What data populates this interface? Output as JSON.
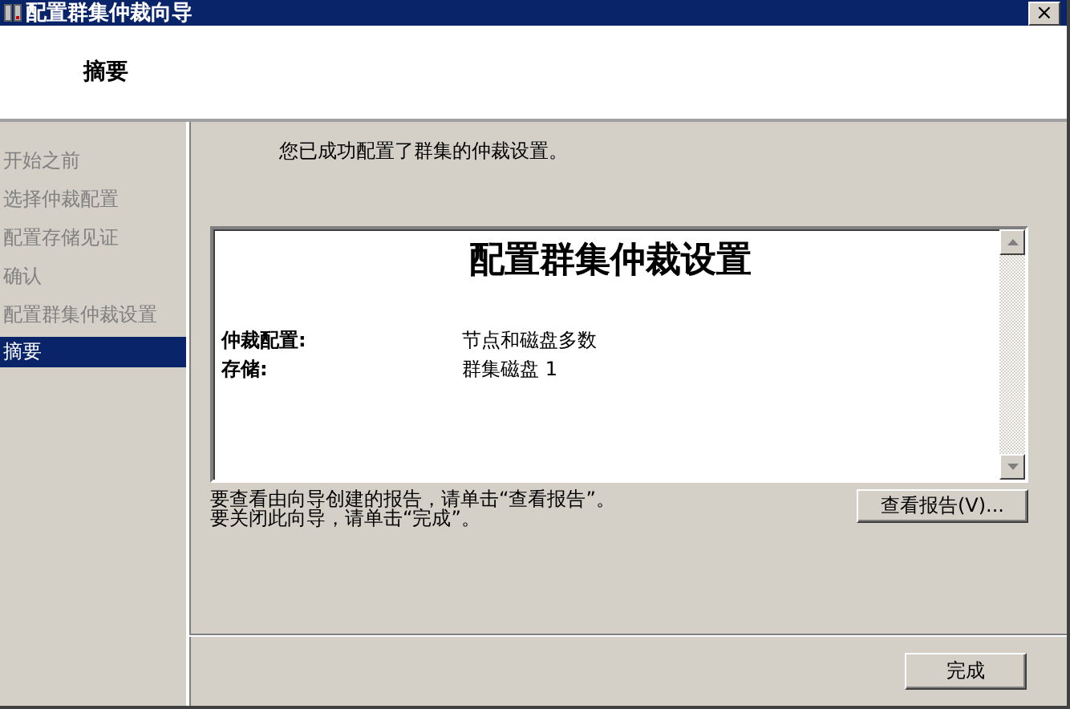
{
  "window": {
    "title": "配置群集仲裁向导",
    "close": "×"
  },
  "header": {
    "title": "摘要"
  },
  "sidebar": {
    "items": [
      {
        "label": "开始之前",
        "selected": false
      },
      {
        "label": "选择仲裁配置",
        "selected": false
      },
      {
        "label": "配置存储见证",
        "selected": false
      },
      {
        "label": "确认",
        "selected": false
      },
      {
        "label": "配置群集仲裁设置",
        "selected": false
      },
      {
        "label": "摘要",
        "selected": true
      }
    ]
  },
  "main": {
    "message": "您已成功配置了群集的仲裁设置。",
    "report": {
      "title": "配置群集仲裁设置",
      "rows": [
        {
          "label": "仲裁配置:",
          "value": "节点和磁盘多数"
        },
        {
          "label": "存储:",
          "value": "群集磁盘 1"
        }
      ]
    },
    "hints": [
      "要查看由向导创建的报告，请单击“查看报告”。",
      "要关闭此向导，请单击“完成”。"
    ],
    "view_report_button": "查看报告(V)..."
  },
  "footer": {
    "finish_button": "完成"
  }
}
